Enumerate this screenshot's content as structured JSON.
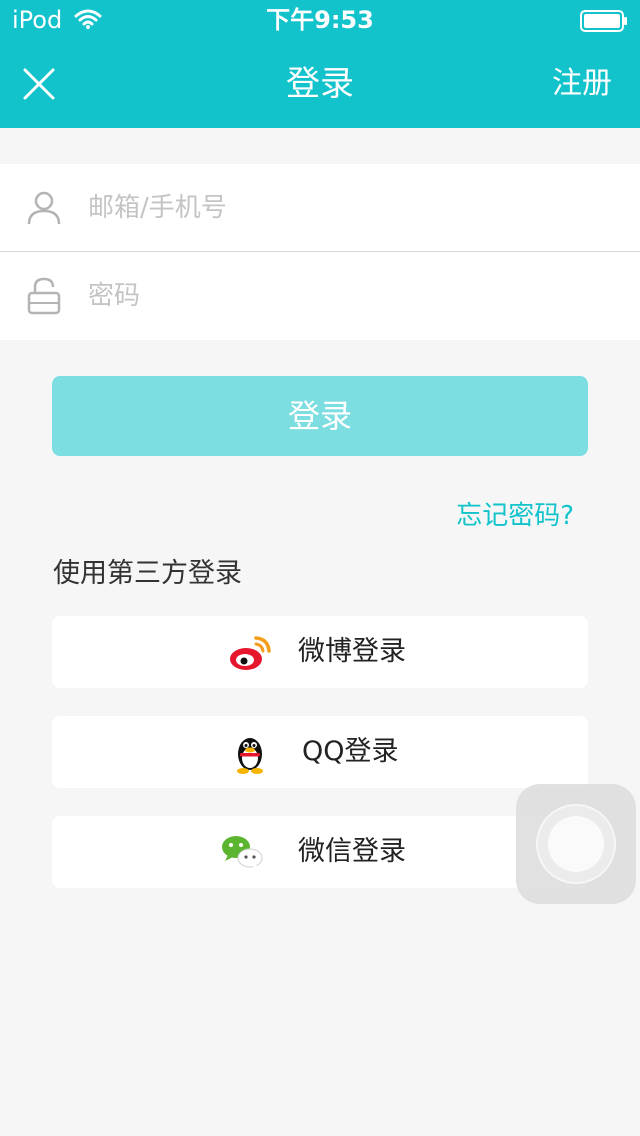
{
  "status_bar": {
    "carrier": "iPod",
    "time": "下午9:53",
    "wifi_icon": "wifi-icon",
    "battery_icon": "battery-icon"
  },
  "nav": {
    "title": "登录",
    "register_label": "注册",
    "close_icon": "close-icon",
    "background_color": "#12c3cc"
  },
  "form": {
    "account": {
      "placeholder": "邮箱/手机号",
      "value": "",
      "icon": "user-icon"
    },
    "password": {
      "placeholder": "密码",
      "value": "",
      "icon": "lock-icon"
    }
  },
  "login_button": {
    "label": "登录",
    "color": "#7ddee2"
  },
  "forgot_password": {
    "label": "忘记密码?",
    "color": "#12c3cc"
  },
  "third_party": {
    "title": "使用第三方登录",
    "buttons": [
      {
        "label": "微博登录",
        "icon": "weibo-icon"
      },
      {
        "label": "QQ登录",
        "icon": "qq-icon"
      },
      {
        "label": "微信登录",
        "icon": "wechat-icon"
      }
    ]
  }
}
